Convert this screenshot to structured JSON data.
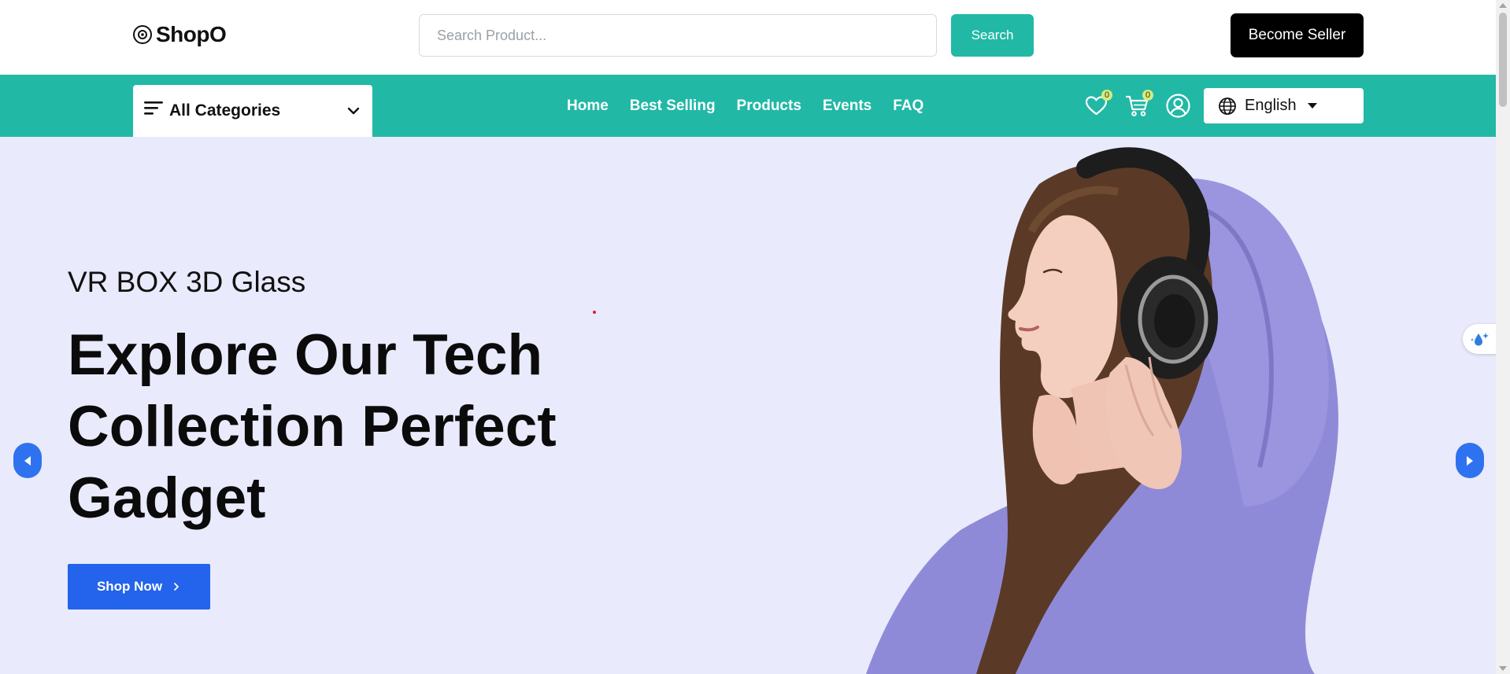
{
  "header": {
    "logo_text": "ShopO",
    "search": {
      "placeholder": "Search Product...",
      "value": ""
    },
    "search_button_label": "Search",
    "seller_button_label": "Become Seller"
  },
  "nav": {
    "categories_label": "All Categories",
    "links": [
      "Home",
      "Best Selling",
      "Products",
      "Events",
      "FAQ"
    ],
    "wishlist_count": "0",
    "cart_count": "0",
    "language": "English"
  },
  "hero": {
    "subtitle": "VR BOX 3D Glass",
    "title": "Explore Our Tech Collection Perfect Gadget",
    "cta_label": "Shop Now"
  },
  "colors": {
    "brand_teal": "#21b8a6",
    "hero_bg": "#e9eafb",
    "cta_blue": "#2463eb",
    "badge": "#d4ec7a"
  },
  "icons": [
    "logo-icon",
    "menu-icon",
    "chevron-down-icon",
    "heart-icon",
    "cart-icon",
    "user-icon",
    "globe-icon",
    "caret-down-icon",
    "chevron-right-icon",
    "arrow-left-icon",
    "arrow-right-icon",
    "droplet-sparkle-icon"
  ]
}
